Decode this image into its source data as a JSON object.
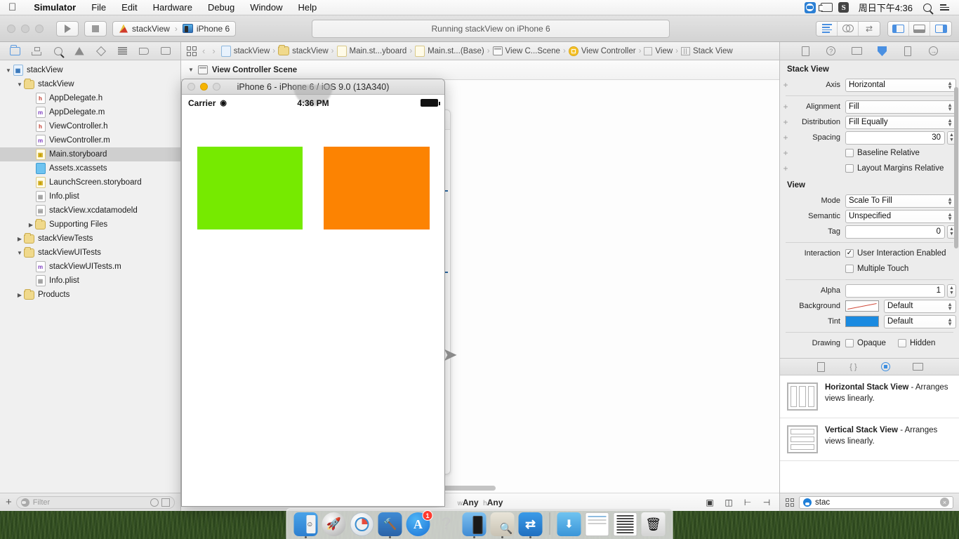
{
  "menubar": {
    "apple": "",
    "items": [
      "Simulator",
      "File",
      "Edit",
      "Hardware",
      "Debug",
      "Window",
      "Help"
    ],
    "clock": "周日下午4:36",
    "right_icons": [
      "teamviewer-icon",
      "display-icon",
      "sogou-icon",
      "spotlight-search-icon",
      "notification-center-icon"
    ]
  },
  "xcode": {
    "toolbar": {
      "run_label": "",
      "stop_label": "",
      "scheme_project": "stackView",
      "scheme_device": "iPhone 6",
      "status": "Running stackView on iPhone 6",
      "editor_segments": [
        "standard-editor",
        "assistant-editor",
        "version-editor"
      ],
      "panel_segments": [
        "toggle-navigator",
        "toggle-debug-area",
        "toggle-utilities"
      ]
    },
    "navigator": {
      "tabs": [
        "project-navigator-icon",
        "symbol-navigator-icon",
        "find-navigator-icon",
        "issue-navigator-icon",
        "test-navigator-icon",
        "debug-navigator-icon",
        "breakpoint-navigator-icon",
        "report-navigator-icon"
      ],
      "tree": [
        {
          "label": "stackView",
          "indent": 0,
          "twisty": "▼",
          "icon": "proj",
          "selected": false
        },
        {
          "label": "stackView",
          "indent": 1,
          "twisty": "▼",
          "icon": "folder",
          "selected": false
        },
        {
          "label": "AppDelegate.h",
          "indent": 2,
          "twisty": "",
          "icon": "h",
          "selected": false
        },
        {
          "label": "AppDelegate.m",
          "indent": 2,
          "twisty": "",
          "icon": "m",
          "selected": false
        },
        {
          "label": "ViewController.h",
          "indent": 2,
          "twisty": "",
          "icon": "h",
          "selected": false
        },
        {
          "label": "ViewController.m",
          "indent": 2,
          "twisty": "",
          "icon": "m",
          "selected": false
        },
        {
          "label": "Main.storyboard",
          "indent": 2,
          "twisty": "",
          "icon": "sb",
          "selected": true
        },
        {
          "label": "Assets.xcassets",
          "indent": 2,
          "twisty": "",
          "icon": "assets",
          "selected": false
        },
        {
          "label": "LaunchScreen.storyboard",
          "indent": 2,
          "twisty": "",
          "icon": "sb",
          "selected": false
        },
        {
          "label": "Info.plist",
          "indent": 2,
          "twisty": "",
          "icon": "plist",
          "selected": false
        },
        {
          "label": "stackView.xcdatamodeld",
          "indent": 2,
          "twisty": "",
          "icon": "xcd",
          "selected": false
        },
        {
          "label": "Supporting Files",
          "indent": 2,
          "twisty": "▶",
          "icon": "folder",
          "selected": false
        },
        {
          "label": "stackViewTests",
          "indent": 1,
          "twisty": "▶",
          "icon": "folder",
          "selected": false
        },
        {
          "label": "stackViewUITests",
          "indent": 1,
          "twisty": "▼",
          "icon": "folder",
          "selected": false
        },
        {
          "label": "stackViewUITests.m",
          "indent": 2,
          "twisty": "",
          "icon": "m",
          "selected": false
        },
        {
          "label": "Info.plist",
          "indent": 2,
          "twisty": "",
          "icon": "plist",
          "selected": false
        },
        {
          "label": "Products",
          "indent": 1,
          "twisty": "▶",
          "icon": "folder",
          "selected": false
        }
      ],
      "filter_placeholder": "Filter",
      "add_label": "+"
    },
    "jump_bar": {
      "crumbs": [
        "stackView",
        "stackView",
        "Main.st...yboard",
        "Main.st...(Base)",
        "View C...Scene",
        "View Controller",
        "View",
        "Stack View"
      ]
    },
    "outline": {
      "scene_label": "View Controller Scene",
      "twisty": "▼"
    },
    "canvas": {
      "dock_icons": [
        "view-controller-icon",
        "first-responder-icon",
        "exit-icon"
      ],
      "size_class_w": "Any",
      "size_class_h": "Any",
      "size_class_w_prefix": "w",
      "size_class_h_prefix": "h",
      "bottom_icons": [
        "constraints-icon",
        "align-icon",
        "pin-icon",
        "resolve-issues-icon"
      ]
    },
    "inspector": {
      "tabs": [
        "file-inspector-icon",
        "quick-help-icon",
        "identity-inspector-icon",
        "attributes-inspector-icon",
        "size-inspector-icon",
        "connections-inspector-icon"
      ],
      "active_tab": 3,
      "sections": [
        {
          "title": "Stack View",
          "rows": [
            {
              "type": "select",
              "label": "Axis",
              "value": "Horizontal",
              "plus": true
            },
            {
              "type": "divider"
            },
            {
              "type": "select",
              "label": "Alignment",
              "value": "Fill",
              "plus": true
            },
            {
              "type": "select",
              "label": "Distribution",
              "value": "Fill Equally",
              "plus": true
            },
            {
              "type": "stepper",
              "label": "Spacing",
              "value": "30",
              "plus": true
            },
            {
              "type": "checkbox",
              "label": "",
              "text": "Baseline Relative",
              "checked": false,
              "plus": true
            },
            {
              "type": "checkbox",
              "label": "",
              "text": "Layout Margins Relative",
              "checked": false,
              "plus": true
            }
          ]
        },
        {
          "title": "View",
          "rows": [
            {
              "type": "select",
              "label": "Mode",
              "value": "Scale To Fill",
              "plus": false
            },
            {
              "type": "select",
              "label": "Semantic",
              "value": "Unspecified",
              "plus": false
            },
            {
              "type": "stepper",
              "label": "Tag",
              "value": "0",
              "plus": false
            },
            {
              "type": "divider"
            },
            {
              "type": "checkbox",
              "label": "Interaction",
              "text": "User Interaction Enabled",
              "checked": true,
              "plus": false
            },
            {
              "type": "checkbox",
              "label": "",
              "text": "Multiple Touch",
              "checked": false,
              "plus": false
            },
            {
              "type": "divider"
            },
            {
              "type": "stepper",
              "label": "Alpha",
              "value": "1",
              "plus": false
            },
            {
              "type": "color",
              "label": "Background",
              "value": "Default",
              "swatch": "redline",
              "plus": false
            },
            {
              "type": "color",
              "label": "Tint",
              "value": "Default",
              "swatch": "blue",
              "plus": false
            },
            {
              "type": "divider"
            },
            {
              "type": "dualcheck",
              "label": "Drawing",
              "text1": "Opaque",
              "checked1": false,
              "text2": "Hidden",
              "checked2": false,
              "plus": false
            }
          ]
        }
      ]
    },
    "library": {
      "tabs": [
        "file-template-library-icon",
        "code-snippet-library-icon",
        "object-library-icon",
        "media-library-icon"
      ],
      "active_tab": 2,
      "items": [
        {
          "title": "Horizontal Stack View",
          "desc": " - Arranges views linearly.",
          "thumb": "horizontal"
        },
        {
          "title": "Vertical Stack View",
          "desc": " - Arranges views linearly.",
          "thumb": "vertical"
        }
      ],
      "search_value": "stac"
    }
  },
  "simulator": {
    "title": "iPhone 6 - iPhone 6 / iOS 9.0 (13A340)",
    "carrier": "Carrier",
    "time": "4:36 PM",
    "green_color": "#76EA00",
    "orange_color": "#FC8302"
  },
  "dock": {
    "apps": [
      {
        "name": "finder",
        "badge": ""
      },
      {
        "name": "launchpad",
        "badge": ""
      },
      {
        "name": "safari",
        "badge": ""
      },
      {
        "name": "xcode",
        "badge": ""
      },
      {
        "name": "app-store",
        "badge": "1"
      },
      {
        "name": "help",
        "badge": ""
      },
      {
        "name": "simulator",
        "badge": ""
      },
      {
        "name": "preview",
        "badge": ""
      },
      {
        "name": "teamviewer",
        "badge": ""
      },
      {
        "name": "downloads-folder",
        "badge": ""
      },
      {
        "name": "document",
        "badge": ""
      },
      {
        "name": "document-2",
        "badge": ""
      },
      {
        "name": "trash",
        "badge": ""
      }
    ]
  }
}
